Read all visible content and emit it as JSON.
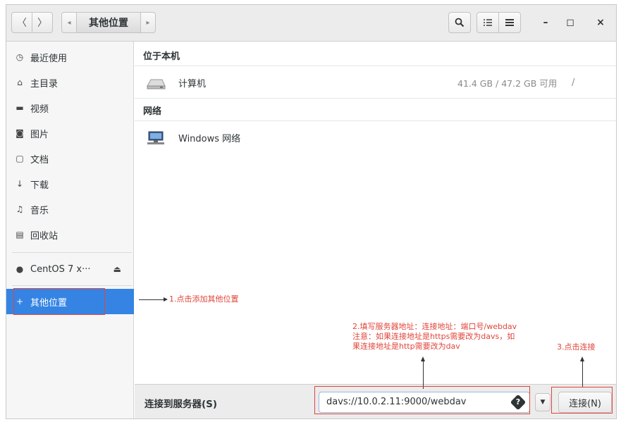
{
  "header": {
    "back_icon": "〈",
    "forward_icon": "〉",
    "path_left_icon": "◂",
    "path_current": "其他位置",
    "path_right_icon": "▸",
    "search_icon": "search-icon",
    "view_icon": "list-view-icon",
    "menu_icon": "hamburger-menu-icon",
    "minimize": "–",
    "maximize": "◻",
    "close": "×"
  },
  "sidebar": {
    "items": [
      {
        "label": "最近使用",
        "icon": "◷"
      },
      {
        "label": "主目录",
        "icon": "⌂"
      },
      {
        "label": "视频",
        "icon": "▬"
      },
      {
        "label": "图片",
        "icon": "◙"
      },
      {
        "label": "文档",
        "icon": "▢"
      },
      {
        "label": "下载",
        "icon": "↓"
      },
      {
        "label": "音乐",
        "icon": "♫"
      },
      {
        "label": "回收站",
        "icon": "▤"
      }
    ],
    "device": {
      "label": "CentOS 7 x···",
      "icon": "●",
      "eject": "⏏"
    },
    "active": {
      "label": "其他位置",
      "icon": "+"
    }
  },
  "main": {
    "section_local": "位于本机",
    "computer": {
      "label": "计算机",
      "info": "41.4 GB / 47.2 GB 可用",
      "mount": "/"
    },
    "section_network": "网络",
    "windows_network": {
      "label": "Windows 网络"
    }
  },
  "actionbar": {
    "label": "连接到服务器(S)",
    "input_value": "davs://10.0.2.11:9000/webdav",
    "help_icon": "?",
    "dropdown_icon": "▼",
    "connect_label": "连接(N)"
  },
  "annotations": {
    "step1": "1.点击添加其他位置",
    "step2_line1": "2.填写服务器地址：连接地址：端口号/webdav",
    "step2_line2": "注意：如果连接地址是https需要改为davs，如",
    "step2_line3": "果连接地址是http需要改为dav",
    "step3": "3.点击连接"
  },
  "colors": {
    "accent": "#3584e4",
    "annotation": "#e0453a"
  }
}
